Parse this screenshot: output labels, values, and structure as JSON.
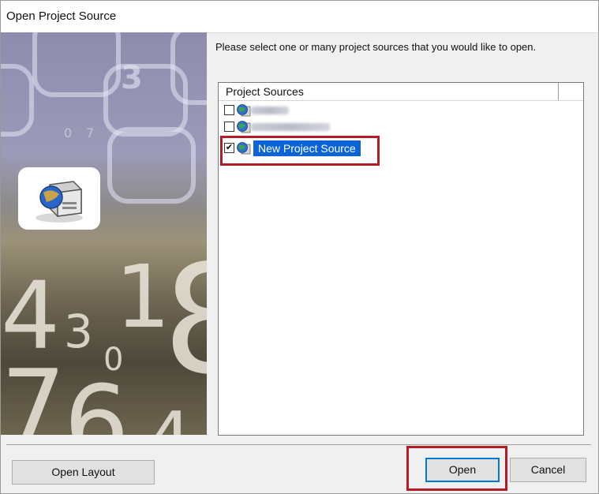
{
  "window": {
    "title": "Open Project Source"
  },
  "prompt": "Please select one or many project sources that you would like to open.",
  "list": {
    "column_header": "Project Sources",
    "items": [
      {
        "label": "",
        "checked": false,
        "selected": false,
        "obscured": true
      },
      {
        "label": "",
        "checked": false,
        "selected": false,
        "obscured": true
      },
      {
        "label": "New Project Source",
        "checked": true,
        "selected": true,
        "obscured": false
      }
    ]
  },
  "banner": {
    "digits": [
      "3",
      "0",
      "7",
      "4",
      "3",
      "1",
      "0",
      "8",
      "7",
      "6",
      "4"
    ]
  },
  "buttons": {
    "open_layout": "Open Layout",
    "open": "Open",
    "cancel": "Cancel"
  },
  "colors": {
    "selection": "#0a64d8",
    "highlight_box": "#b31c24",
    "default_button_border": "#0078d7"
  },
  "icons": {
    "project_source": "globe-server-icon",
    "banner_logo": "project-source-logo-icon"
  }
}
